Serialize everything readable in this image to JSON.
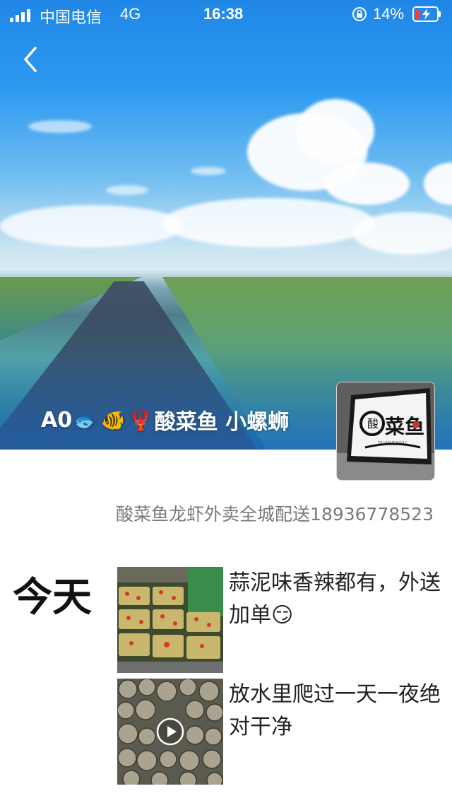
{
  "status_bar": {
    "carrier": "中国电信",
    "network": "4G",
    "time": "16:38",
    "battery": "14%"
  },
  "icons": {
    "back": "chevron-left-icon",
    "lock": "rotation-lock-icon",
    "battery": "battery-charging-icon",
    "play": "play-icon"
  },
  "profile": {
    "name_prefix": "A0",
    "name_emojis": [
      "🐟",
      "🐠",
      "🦞"
    ],
    "name_text": "酸菜鱼 小螺蛳",
    "signature": "酸菜鱼龙虾外卖全城配送18936778523",
    "avatar_text_top": "酸",
    "avatar_text_main": "菜鱼",
    "avatar_text_sub": "SUANCAIYU"
  },
  "feed": {
    "date_label": "今天",
    "posts": [
      {
        "text": "蒜泥味香辣都有，外送加单😏",
        "type": "image"
      },
      {
        "text": "放水里爬过一天一夜绝对干净",
        "type": "video"
      }
    ]
  },
  "colors": {
    "signature_gray": "#7a7a7a",
    "text_dark": "#222222"
  }
}
